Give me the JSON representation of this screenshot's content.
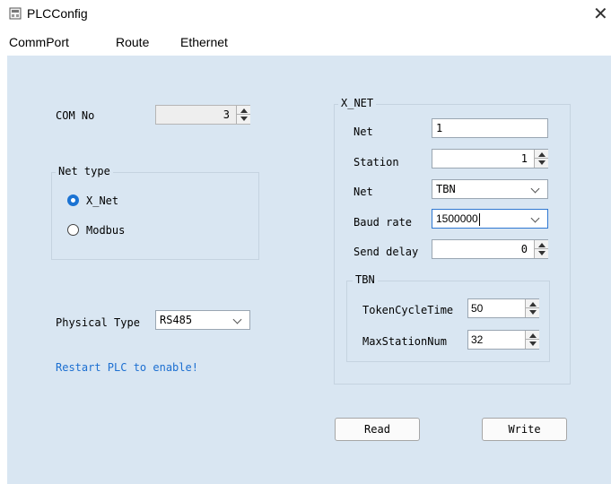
{
  "window": {
    "title": "PLCConfig",
    "close_glyph": "✕"
  },
  "menu": {
    "items": [
      "CommPort",
      "Route",
      "Ethernet"
    ]
  },
  "left": {
    "com_no_label": "COM No",
    "com_no_value": "3",
    "net_type": {
      "title": "Net type",
      "options": [
        {
          "label": "X_Net",
          "selected": true
        },
        {
          "label": "Modbus",
          "selected": false
        }
      ]
    },
    "physical_type_label": "Physical Type",
    "physical_type_value": "RS485",
    "restart_note": "Restart PLC to enable!"
  },
  "xnet": {
    "title": "X_NET",
    "net_label": "Net",
    "net_value": "1",
    "station_label": "Station",
    "station_value": "1",
    "net2_label": "Net",
    "net2_value": "TBN",
    "baud_label": "Baud rate",
    "baud_value": "1500000",
    "send_delay_label": "Send delay",
    "send_delay_value": "0",
    "tbn": {
      "title": "TBN",
      "token_label": "TokenCycleTime",
      "token_value": "50",
      "maxst_label": "MaxStationNum",
      "maxst_value": "32"
    }
  },
  "buttons": {
    "read": "Read",
    "write": "Write"
  },
  "colors": {
    "client_bg": "#d9e6f2",
    "accent": "#1b73d3",
    "note": "#1c6fd1"
  }
}
